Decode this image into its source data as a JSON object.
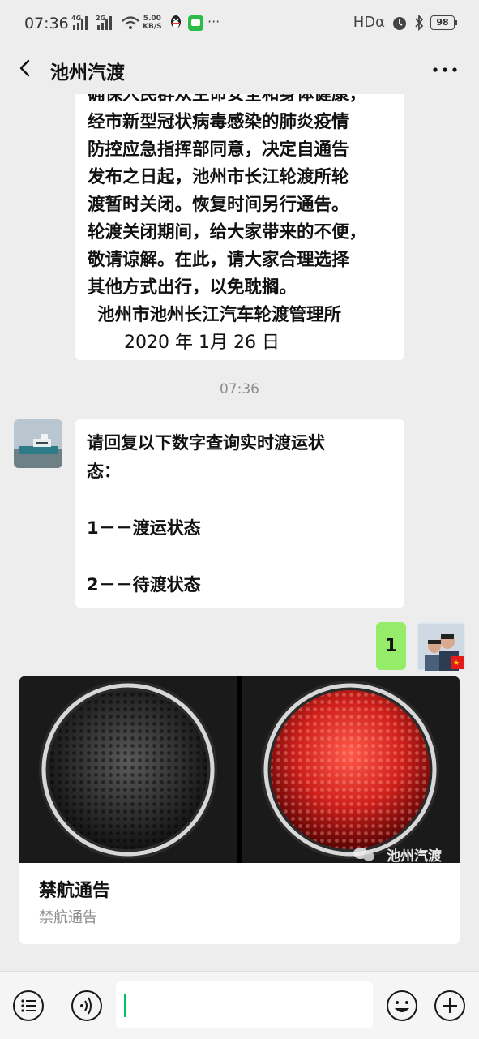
{
  "status_bar": {
    "time": "07:36",
    "net1": "4G",
    "net2": "2G",
    "speed_value": "5.00",
    "speed_unit": "KB/S",
    "more": "···",
    "hd": "HDα",
    "battery": "98"
  },
  "header": {
    "title": "池州汽渡"
  },
  "notice": {
    "lines": [
      "确保人民群众生命安全和身体健康，",
      "经市新型冠状病毒感染的肺炎疫情",
      "防控应急指挥部同意，决定自通告",
      "发布之日起，池州市长江轮渡所轮",
      "渡暂时关闭。恢复时间另行通告。",
      "轮渡关闭期间，给大家带来的不便，",
      "敬请谅解。在此，请大家合理选择",
      "其他方式出行，以免耽搁。"
    ],
    "signature": "池州市池州长江汽车轮渡管理所",
    "date": "2020 年 1月 26 日"
  },
  "timestamp": "07:36",
  "reply": {
    "line1": "请回复以下数字查询实时渡运状",
    "line2": "态：",
    "line3": "1－－渡运状态",
    "line4": "2－－待渡状态"
  },
  "my_message": "1",
  "card": {
    "watermark": "池州汽渡",
    "title": "禁航通告",
    "subtitle": "禁航通告"
  },
  "colors": {
    "background": "#ededed",
    "my_bubble": "#95ec69",
    "accent": "#07c160",
    "red_light": "#d0201c"
  },
  "icons": [
    "back-arrow-icon",
    "more-dots-icon",
    "list-icon",
    "voice-icon",
    "emoji-icon",
    "plus-icon"
  ]
}
